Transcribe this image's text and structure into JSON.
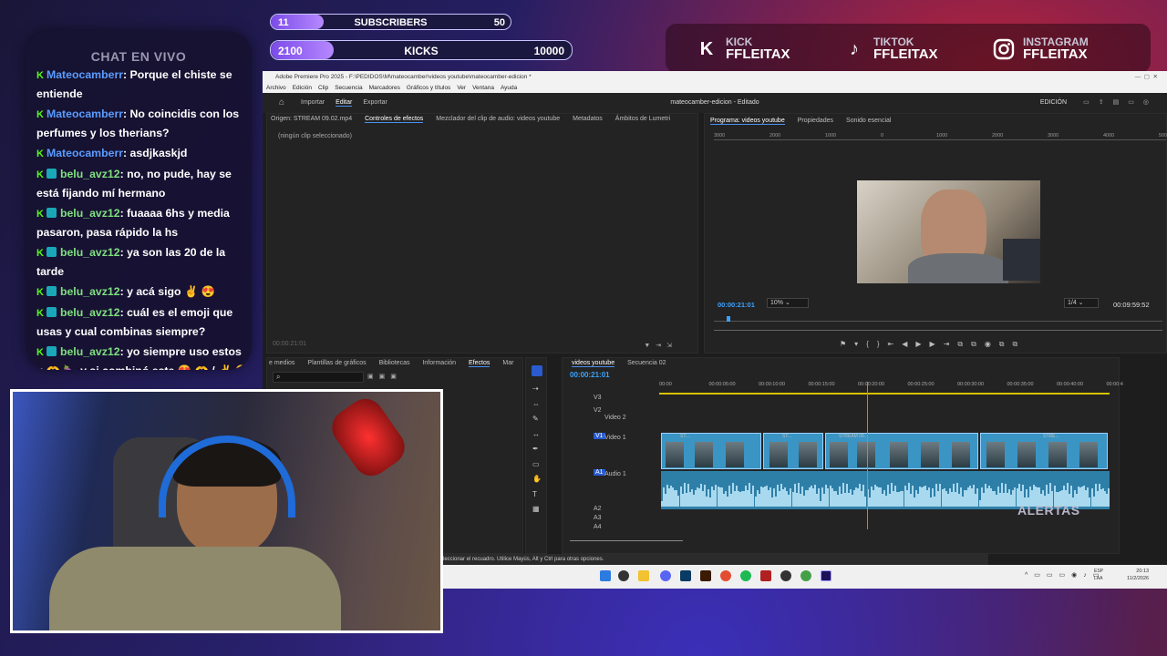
{
  "overlay": {
    "subscribers": {
      "label": "SUBSCRIBERS",
      "current": "11",
      "goal": "50",
      "progress": 0.22
    },
    "kicks": {
      "label": "KICKS",
      "current": "2100",
      "goal": "10000",
      "progress": 0.21
    },
    "socials": [
      {
        "icon": "kick-icon",
        "platform": "KICK",
        "handle": "FFLEITAX"
      },
      {
        "icon": "tiktok-icon",
        "platform": "TIKTOK",
        "handle": "FFLEITAX"
      },
      {
        "icon": "instagram-icon",
        "platform": "INSTAGRAM",
        "handle": "FFLEITAX"
      }
    ],
    "alerts_label": "ALERTAS"
  },
  "chat": {
    "title": "CHAT EN VIVO",
    "messages": [
      {
        "user": "Mateocamberr",
        "text": ": Porque el chiste se entiende",
        "color": "blue"
      },
      {
        "user": "Mateocamberr",
        "text": ": No coincidis con los perfumes y los therians?",
        "color": "blue"
      },
      {
        "user": "Mateocamberr",
        "text": ": asdjkaskjd",
        "color": "blue"
      },
      {
        "user": "belu_avz12",
        "text": ": no, no pude, hay se está fijando mí hermano",
        "color": "green"
      },
      {
        "user": "belu_avz12",
        "text": ": fuaaaa 6hs y media pasaron, pasa rápido la hs",
        "color": "green"
      },
      {
        "user": "belu_avz12",
        "text": ": ya son las 20 de la tarde",
        "color": "green"
      },
      {
        "user": "belu_avz12",
        "text": ": y acá sigo ✌️ 😍",
        "color": "green"
      },
      {
        "user": "belu_avz12",
        "text": ": cuál es el emoji que usas y cual combinas siempre?",
        "color": "green"
      },
      {
        "user": "belu_avz12",
        "text": ": yo siempre uso estos ♥ 🫶 🍆 y si combinó este 😍 🫶 / ✌️ 😍 /",
        "color": "green"
      }
    ]
  },
  "premiere": {
    "window_title": "Adobe Premiere Pro 2025 - F:\\PEDIDOS\\M\\mateocamber\\videos youtube\\mateocamber-edicion *",
    "menu": [
      "Archivo",
      "Edición",
      "Clip",
      "Secuencia",
      "Marcadores",
      "Gráficos y títulos",
      "Ver",
      "Ventana",
      "Ayuda"
    ],
    "workspace": {
      "tabs": [
        "Importar",
        "Editar",
        "Exportar"
      ],
      "active": "Editar",
      "project": "mateocamber-edicion - Editado",
      "mode": "EDICIÓN"
    },
    "source_panel": {
      "tabs": [
        "Origen: STREAM 09.02.mp4",
        "Controles de efectos",
        "Mezclador del clip de audio: videos youtube",
        "Metadatos",
        "Ámbitos de Lumetri"
      ],
      "active": "Controles de efectos",
      "empty_text": "(ningún clip seleccionado)",
      "timecode": "00:00:21:01"
    },
    "program": {
      "tabs": [
        "Programa: videos youtube",
        "Propiedades",
        "Sonido esencial"
      ],
      "timecode": "00:00:21:01",
      "zoom": "10%",
      "quality": "1/4",
      "duration": "00:09:59:52",
      "ruler": [
        "3000",
        "2000",
        "1000",
        "0",
        "1000",
        "2000",
        "3000",
        "4000",
        "5000"
      ]
    },
    "effects_panel": {
      "tabs": [
        "e medios",
        "Plantillas de gráficos",
        "Bibliotecas",
        "Información",
        "Efectos",
        "Mar"
      ],
      "active": "Efectos"
    },
    "timeline": {
      "tabs": [
        "videos youtube",
        "Secuencia 02"
      ],
      "timecode": "00:00:21:01",
      "ruler": [
        "00:00",
        "00:00:05:00",
        "00:00:10:00",
        "00:00:15:00",
        "00:00:20:00",
        "00:00:25:00",
        "00:00:30:00",
        "00:00:35:00",
        "00:00:40:00",
        "00:00:4"
      ],
      "tracks": [
        {
          "id": "V3",
          "name": ""
        },
        {
          "id": "V2",
          "name": "Video 2"
        },
        {
          "id": "V1",
          "name": "Video 1"
        },
        {
          "id": "A1",
          "name": "Audio 1"
        },
        {
          "id": "A2",
          "name": ""
        },
        {
          "id": "A3",
          "name": ""
        },
        {
          "id": "A4",
          "name": ""
        }
      ],
      "clip_labels": [
        "ST...",
        "ST...",
        "STREAM 09...",
        "STRE..."
      ]
    },
    "status": "leccionar el recuadro. Utilice Mayús, Alt y Ctrl para otras opciones.",
    "tray": {
      "lang": "ESP\nLAA",
      "time": "20:13",
      "date": "11/2/2026"
    }
  }
}
